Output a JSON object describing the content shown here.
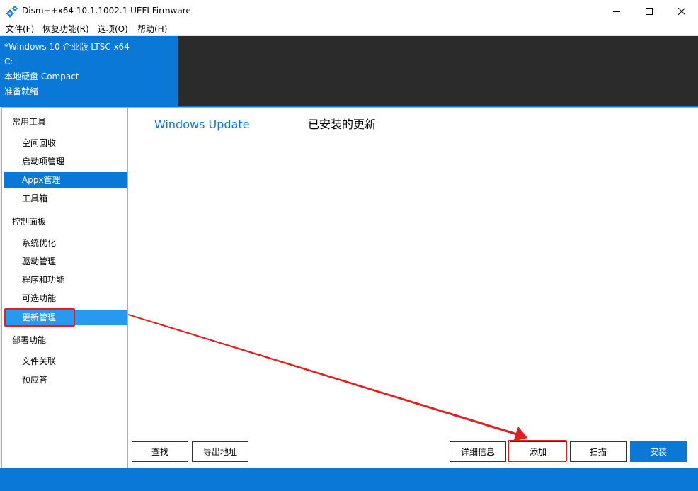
{
  "window": {
    "title": "Dism++x64 10.1.1002.1 UEFI Firmware"
  },
  "menu": [
    {
      "label": "文件(F)"
    },
    {
      "label": "恢复功能(R)"
    },
    {
      "label": "选项(O)"
    },
    {
      "label": "帮助(H)"
    }
  ],
  "header": {
    "os": "*Windows 10 企业版 LTSC x64",
    "drive": "C:",
    "disk": "本地硬盘 Compact",
    "status": "准备就绪"
  },
  "sidebar": {
    "groups": [
      {
        "label": "常用工具",
        "items": [
          {
            "label": "空间回收"
          },
          {
            "label": "启动项管理"
          },
          {
            "label": "Appx管理"
          },
          {
            "label": "工具箱"
          }
        ]
      },
      {
        "label": "控制面板",
        "items": [
          {
            "label": "系统优化"
          },
          {
            "label": "驱动管理"
          },
          {
            "label": "程序和功能"
          },
          {
            "label": "可选功能"
          },
          {
            "label": "更新管理"
          }
        ]
      },
      {
        "label": "部署功能",
        "items": [
          {
            "label": "文件关联"
          },
          {
            "label": "预应答"
          }
        ]
      }
    ]
  },
  "main": {
    "tabs": [
      {
        "label": "Windows Update"
      },
      {
        "label": "已安装的更新"
      }
    ],
    "buttons": {
      "find": "查找",
      "export": "导出地址",
      "details": "详细信息",
      "add": "添加",
      "scan": "扫描",
      "install": "安装"
    }
  },
  "colors": {
    "accent": "#0a78d7",
    "hover": "#2799ee",
    "dark": "#2b2b2b",
    "annotation": "#e02020"
  }
}
